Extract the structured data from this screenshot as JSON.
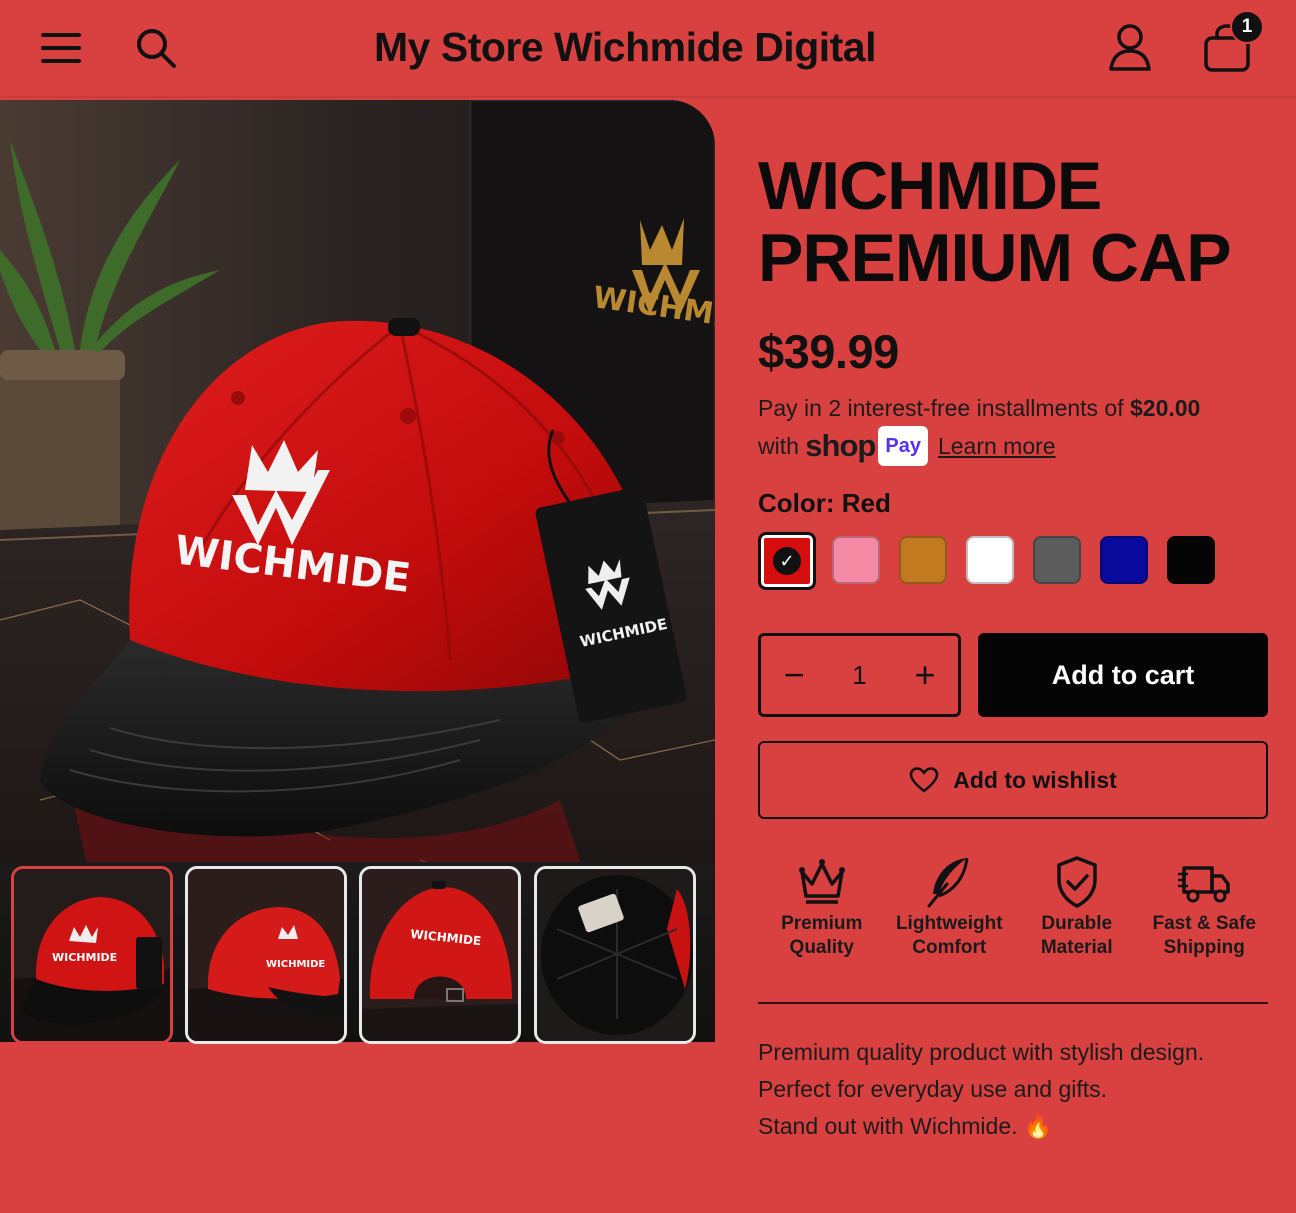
{
  "header": {
    "store_title": "My Store Wichmide Digital",
    "menu_icon": "hamburger-menu-icon",
    "search_icon": "search-icon",
    "account_icon": "user-icon",
    "cart_icon": "shopping-bag-icon",
    "cart_count": "1"
  },
  "gallery": {
    "brand_text": "WICHMIDE",
    "tag_text": "WICHMIDE",
    "box_text": "WICHMID",
    "thumbnails": [
      {
        "name": "thumbnail-front-angle",
        "active": true
      },
      {
        "name": "thumbnail-side"
      },
      {
        "name": "thumbnail-back",
        "text": "WICHMIDE"
      },
      {
        "name": "thumbnail-underside"
      }
    ]
  },
  "product": {
    "title_line1": "WICHMIDE",
    "title_line2": "PREMIUM CAP",
    "price": "$39.99",
    "installments_prefix": "Pay in 2 interest-free installments of ",
    "installment_amount": "$20.00",
    "installments_with": "with ",
    "shop_logo": "shop",
    "pay_badge": "Pay",
    "learn_more": "Learn more",
    "color_label": "Color: Red",
    "swatches": [
      {
        "name": "Red",
        "hex": "#d50d0d",
        "selected": true
      },
      {
        "name": "Pink",
        "hex": "#f48aa3"
      },
      {
        "name": "Brown",
        "hex": "#c27a20"
      },
      {
        "name": "White",
        "hex": "#ffffff"
      },
      {
        "name": "Gray",
        "hex": "#5c5c5c"
      },
      {
        "name": "Blue",
        "hex": "#0a0a9c"
      },
      {
        "name": "Black",
        "hex": "#050505"
      }
    ],
    "quantity": "1",
    "qty_minus": "−",
    "qty_plus": "+",
    "add_to_cart": "Add to cart",
    "add_to_wishlist": "Add to wishlist",
    "features": [
      {
        "icon": "crown-icon",
        "line1": "Premium",
        "line2": "Quality"
      },
      {
        "icon": "feather-icon",
        "line1": "Lightweight",
        "line2": "Comfort"
      },
      {
        "icon": "shield-check-icon",
        "line1": "Durable",
        "line2": "Material"
      },
      {
        "icon": "truck-icon",
        "line1": "Fast & Safe",
        "line2": "Shipping"
      }
    ],
    "description": [
      "Premium quality product with stylish design.",
      "Perfect for everyday use and gifts.",
      "Stand out with Wichmide. 🔥"
    ]
  },
  "colors": {
    "background": "#d94141",
    "button_dark": "#050505",
    "text": "#111111"
  }
}
